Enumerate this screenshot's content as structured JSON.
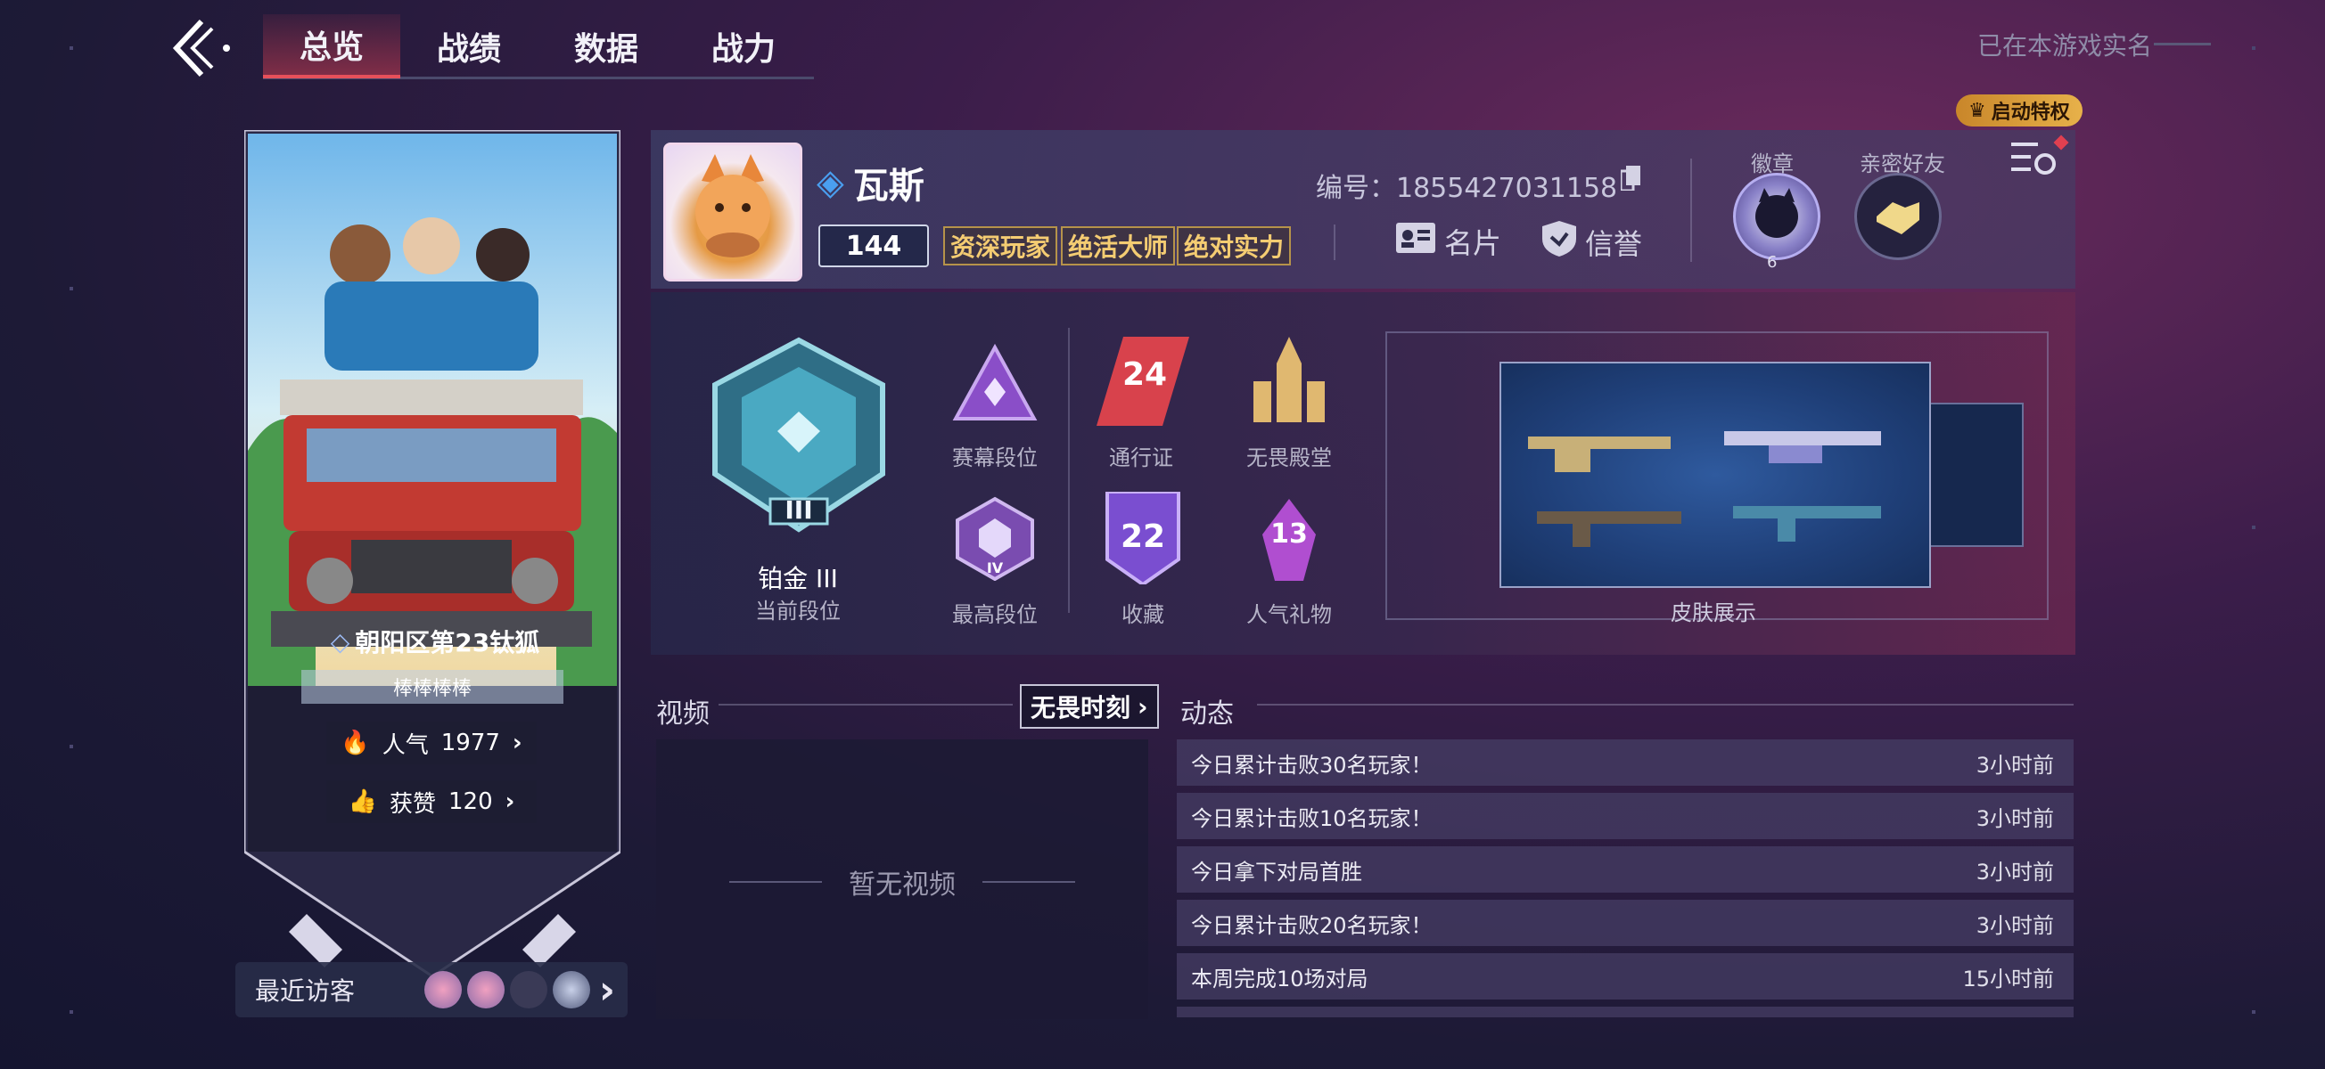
{
  "nav": {
    "tabs": [
      {
        "label": "总览",
        "active": true
      },
      {
        "label": "战绩",
        "active": false
      },
      {
        "label": "数据",
        "active": false
      },
      {
        "label": "战力",
        "active": false
      }
    ],
    "realname_notice": "已在本游戏实名",
    "privilege_label": "启动特权"
  },
  "card": {
    "location_title": "朝阳区第23钛狐",
    "motto": "棒棒棒棒",
    "popularity_label": "人气",
    "popularity_value": "1977",
    "likes_label": "获赞",
    "likes_value": "120",
    "visitors_label": "最近访客"
  },
  "profile": {
    "name": "瓦斯",
    "level": "144",
    "tags": [
      "资深玩家",
      "绝活大师",
      "绝对实力"
    ],
    "id_text": "编号：1855427031158",
    "namecard_label": "名片",
    "credit_label": "信誉",
    "medal_label": "徽章",
    "medal_count": "6",
    "friends_label": "亲密好友"
  },
  "stats": {
    "current_rank_name": "铂金 III",
    "current_rank_label": "当前段位",
    "rank_numeral": "III",
    "act_rank_label": "赛幕段位",
    "peak_rank_label": "最高段位",
    "peak_numeral": "IV",
    "battlepass_label": "通行证",
    "battlepass_value": "24",
    "hall_label": "无畏殿堂",
    "collection_label": "收藏",
    "collection_value": "22",
    "gifts_label": "人气礼物",
    "gifts_value": "13",
    "skins_label": "皮肤展示"
  },
  "video": {
    "title": "视频",
    "moments_label": "无畏时刻",
    "empty_text": "暂无视频"
  },
  "feed": {
    "title": "动态",
    "items": [
      {
        "text": "今日累计击败30名玩家！",
        "time": "3小时前"
      },
      {
        "text": "今日累计击败10名玩家！",
        "time": "3小时前"
      },
      {
        "text": "今日拿下对局首胜",
        "time": "3小时前"
      },
      {
        "text": "今日累计击败20名玩家！",
        "time": "3小时前"
      },
      {
        "text": "本周完成10场对局",
        "time": "15小时前"
      }
    ]
  },
  "colors": {
    "accent_red": "#e6505a",
    "gold": "#f4cc72",
    "teal_rank": "#5fd0d8",
    "purple_rank": "#a064e0"
  }
}
